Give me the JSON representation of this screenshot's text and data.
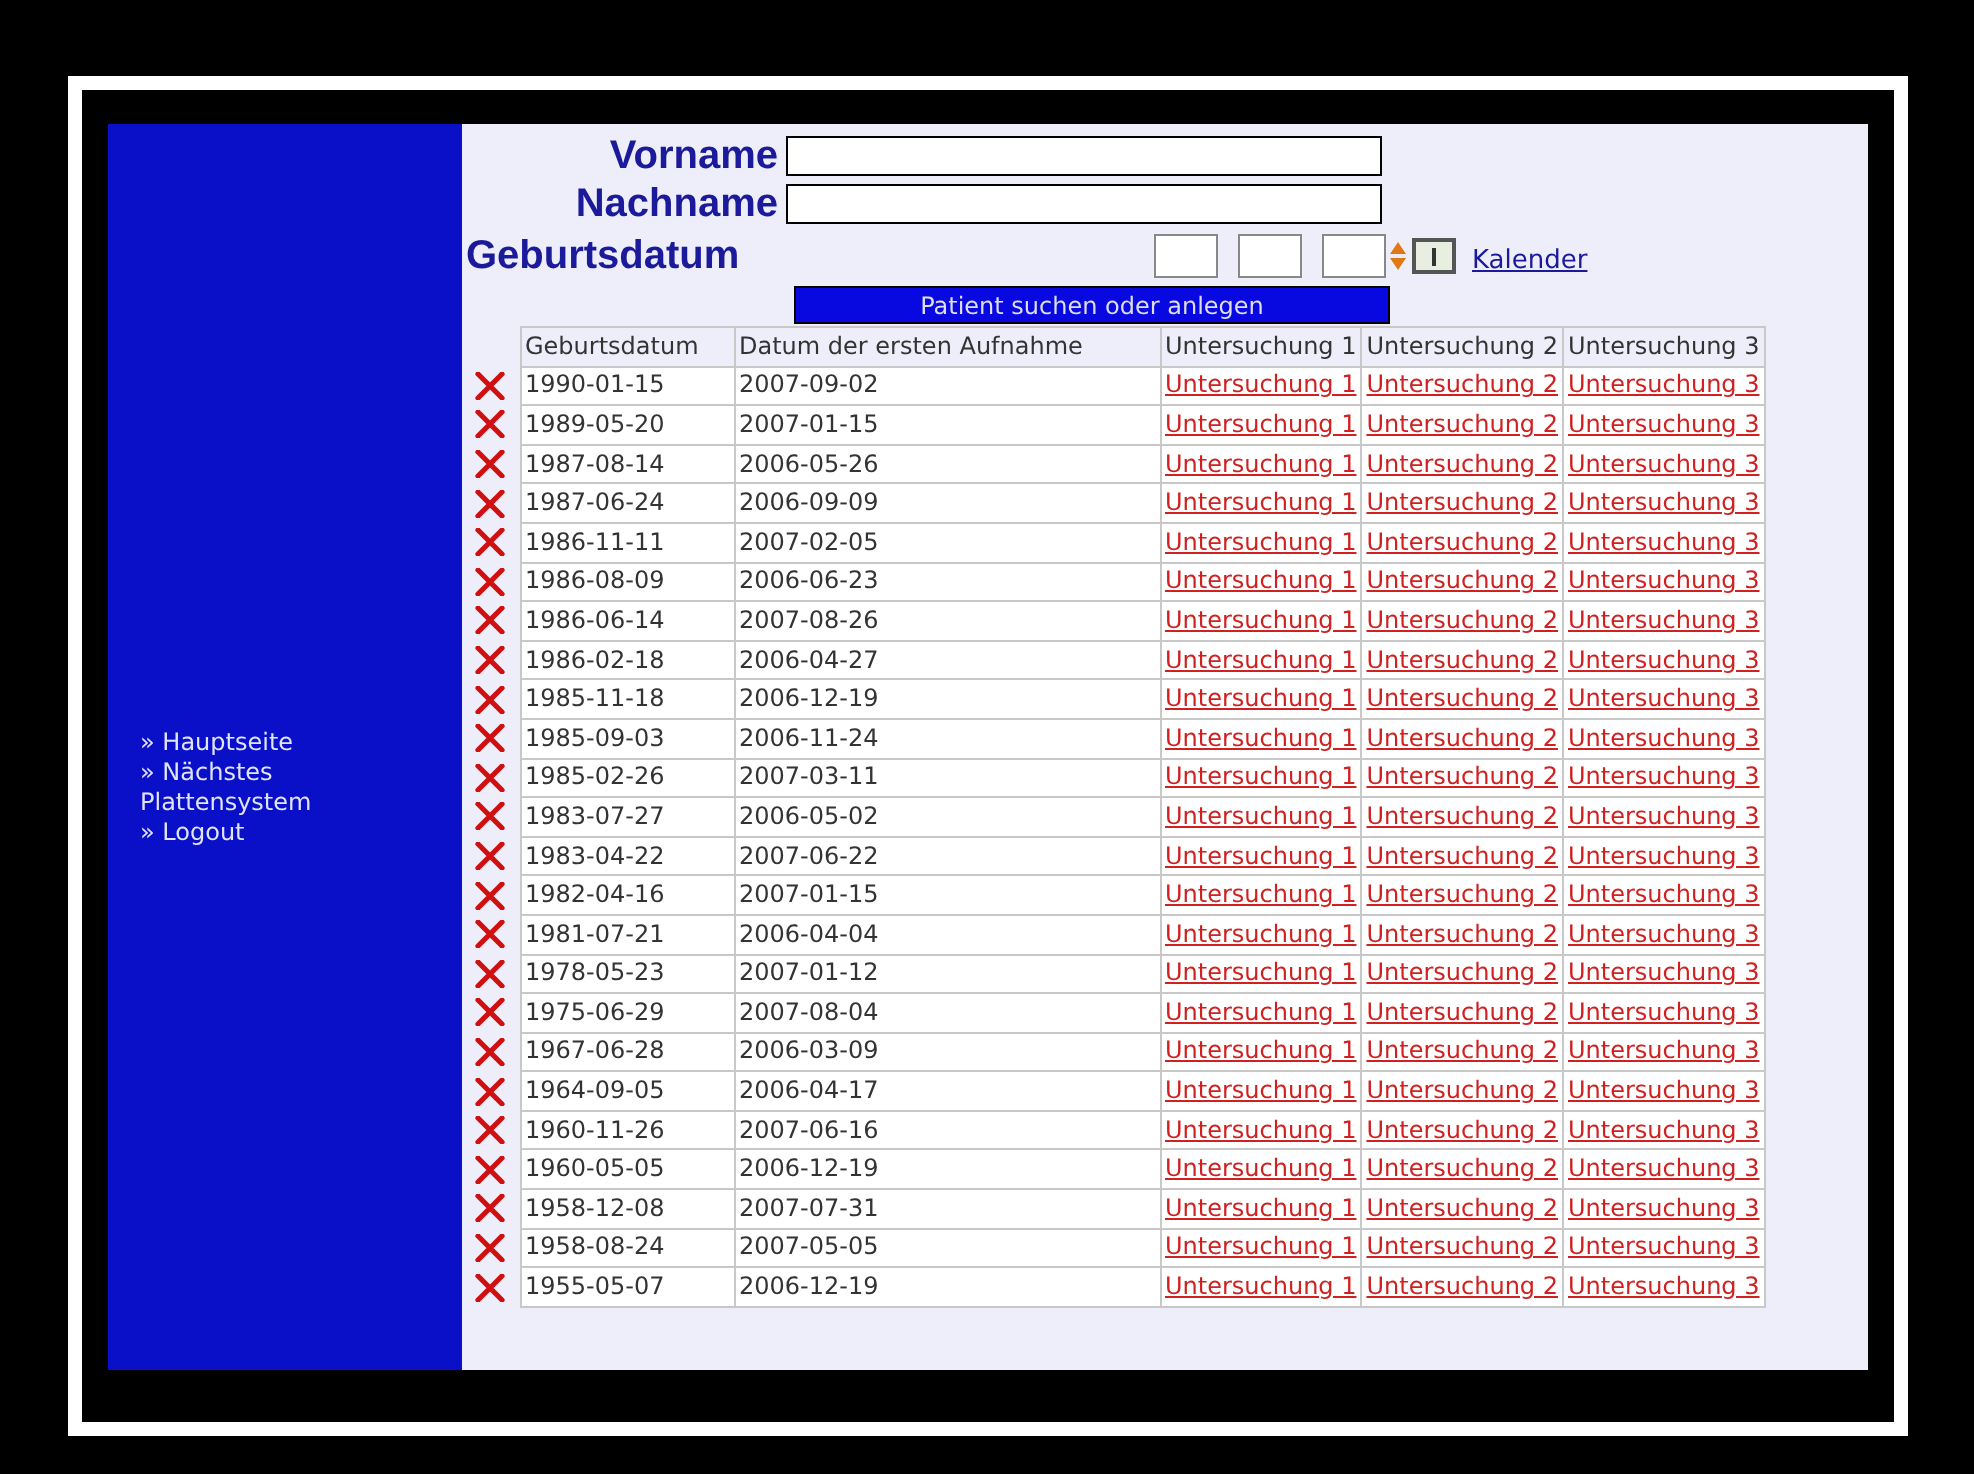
{
  "sidebar": {
    "items": [
      {
        "arrow": "»",
        "label": "Hauptseite"
      },
      {
        "arrow": "»",
        "label": "Nächstes Plattensystem"
      },
      {
        "arrow": "»",
        "label": "Logout"
      }
    ]
  },
  "form": {
    "fields": [
      {
        "label": "Vorname"
      },
      {
        "label": "Nachname"
      }
    ],
    "date_label": "Geburtsdatum",
    "calendar_link": "Kalender",
    "submit": "Patient suchen oder anlegen"
  },
  "table": {
    "columns": [
      "Geburtsdatum",
      "Datum der ersten Aufnahme",
      "Untersuchung 1",
      "Untersuchung 2",
      "Untersuchung 3"
    ],
    "rows": [
      {
        "birth": "1990-01-15",
        "admission": "2007-09-02",
        "links": [
          "Untersuchung 1",
          "Untersuchung 2",
          "Untersuchung 3"
        ]
      },
      {
        "birth": "1989-05-20",
        "admission": "2007-01-15",
        "links": [
          "Untersuchung 1",
          "Untersuchung 2",
          "Untersuchung 3"
        ]
      },
      {
        "birth": "1987-08-14",
        "admission": "2006-05-26",
        "links": [
          "Untersuchung 1",
          "Untersuchung 2",
          "Untersuchung 3"
        ]
      },
      {
        "birth": "1987-06-24",
        "admission": "2006-09-09",
        "links": [
          "Untersuchung 1",
          "Untersuchung 2",
          "Untersuchung 3"
        ]
      },
      {
        "birth": "1986-11-11",
        "admission": "2007-02-05",
        "links": [
          "Untersuchung 1",
          "Untersuchung 2",
          "Untersuchung 3"
        ]
      },
      {
        "birth": "1986-08-09",
        "admission": "2006-06-23",
        "links": [
          "Untersuchung 1",
          "Untersuchung 2",
          "Untersuchung 3"
        ]
      },
      {
        "birth": "1986-06-14",
        "admission": "2007-08-26",
        "links": [
          "Untersuchung 1",
          "Untersuchung 2",
          "Untersuchung 3"
        ]
      },
      {
        "birth": "1986-02-18",
        "admission": "2006-04-27",
        "links": [
          "Untersuchung 1",
          "Untersuchung 2",
          "Untersuchung 3"
        ]
      },
      {
        "birth": "1985-11-18",
        "admission": "2006-12-19",
        "links": [
          "Untersuchung 1",
          "Untersuchung 2",
          "Untersuchung 3"
        ]
      },
      {
        "birth": "1985-09-03",
        "admission": "2006-11-24",
        "links": [
          "Untersuchung 1",
          "Untersuchung 2",
          "Untersuchung 3"
        ]
      },
      {
        "birth": "1985-02-26",
        "admission": "2007-03-11",
        "links": [
          "Untersuchung 1",
          "Untersuchung 2",
          "Untersuchung 3"
        ]
      },
      {
        "birth": "1983-07-27",
        "admission": "2006-05-02",
        "links": [
          "Untersuchung 1",
          "Untersuchung 2",
          "Untersuchung 3"
        ]
      },
      {
        "birth": "1983-04-22",
        "admission": "2007-06-22",
        "links": [
          "Untersuchung 1",
          "Untersuchung 2",
          "Untersuchung 3"
        ]
      },
      {
        "birth": "1982-04-16",
        "admission": "2007-01-15",
        "links": [
          "Untersuchung 1",
          "Untersuchung 2",
          "Untersuchung 3"
        ]
      },
      {
        "birth": "1981-07-21",
        "admission": "2006-04-04",
        "links": [
          "Untersuchung 1",
          "Untersuchung 2",
          "Untersuchung 3"
        ]
      },
      {
        "birth": "1978-05-23",
        "admission": "2007-01-12",
        "links": [
          "Untersuchung 1",
          "Untersuchung 2",
          "Untersuchung 3"
        ]
      },
      {
        "birth": "1975-06-29",
        "admission": "2007-08-04",
        "links": [
          "Untersuchung 1",
          "Untersuchung 2",
          "Untersuchung 3"
        ]
      },
      {
        "birth": "1967-06-28",
        "admission": "2006-03-09",
        "links": [
          "Untersuchung 1",
          "Untersuchung 2",
          "Untersuchung 3"
        ]
      },
      {
        "birth": "1964-09-05",
        "admission": "2006-04-17",
        "links": [
          "Untersuchung 1",
          "Untersuchung 2",
          "Untersuchung 3"
        ]
      },
      {
        "birth": "1960-11-26",
        "admission": "2007-06-16",
        "links": [
          "Untersuchung 1",
          "Untersuchung 2",
          "Untersuchung 3"
        ]
      },
      {
        "birth": "1960-05-05",
        "admission": "2006-12-19",
        "links": [
          "Untersuchung 1",
          "Untersuchung 2",
          "Untersuchung 3"
        ]
      },
      {
        "birth": "1958-12-08",
        "admission": "2007-07-31",
        "links": [
          "Untersuchung 1",
          "Untersuchung 2",
          "Untersuchung 3"
        ]
      },
      {
        "birth": "1958-08-24",
        "admission": "2007-05-05",
        "links": [
          "Untersuchung 1",
          "Untersuchung 2",
          "Untersuchung 3"
        ]
      },
      {
        "birth": "1955-05-07",
        "admission": "2006-12-19",
        "links": [
          "Untersuchung 1",
          "Untersuchung 2",
          "Untersuchung 3"
        ]
      }
    ]
  }
}
